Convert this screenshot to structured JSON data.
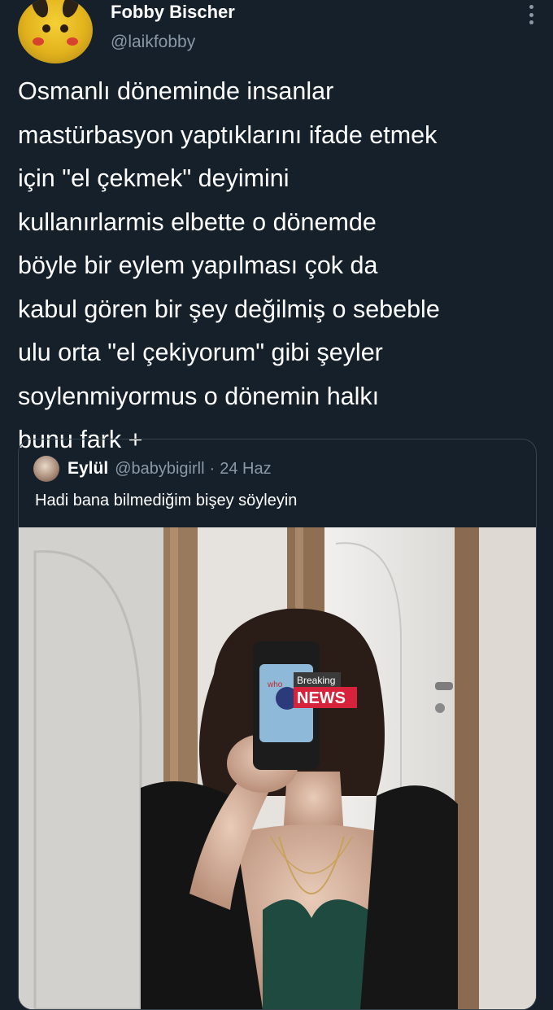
{
  "tweet": {
    "author_name": "Fobby Bischer",
    "author_handle": "@laikfobby",
    "text": "Osmanlı döneminde insanlar\nmastürbasyon yaptıklarını ifade etmek\niçin \"el çekmek\" deyimini\nkullanırlarmis elbette o dönemde\nböyle bir eylem yapılması çok da\nkabul gören bir şey değilmiş o sebeble\nulu orta \"el çekiyorum\" gibi şeyler\nsoylenmiyormus o dönemin halkı\nbunu fark +",
    "more_icon": "more-options-icon"
  },
  "quoted_tweet": {
    "author_name": "Eylül",
    "author_handle": "@babybigirll",
    "separator": "·",
    "date": "24 Haz",
    "text": "Hadi bana bilmediğim bişey söyleyin",
    "image": {
      "sticker_top": "Breaking",
      "sticker_bottom": "NEWS",
      "phone_case_text": "who"
    }
  },
  "colors": {
    "background": "#15202b",
    "text_primary": "#ffffff",
    "text_secondary": "#8b98a5",
    "border": "#38444d",
    "sticker_red": "#d6223a"
  }
}
